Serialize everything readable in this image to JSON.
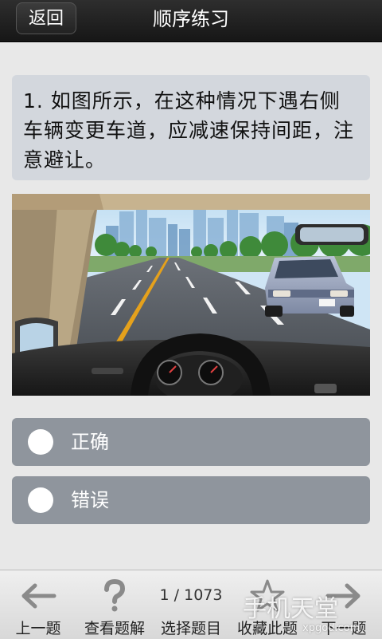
{
  "header": {
    "back_label": "返回",
    "title": "顺序练习"
  },
  "question": {
    "text": "1. 如图所示，在这种情况下遇右侧车辆变更车道，应减速保持间距，注意避让。"
  },
  "options": [
    {
      "label": "正确"
    },
    {
      "label": "错误"
    }
  ],
  "toolbar": {
    "prev_label": "上一题",
    "explain_label": "查看题解",
    "counter": "1 / 1073",
    "select_label": "选择题目",
    "favorite_label": "收藏此题",
    "next_label": "下一题"
  },
  "watermark": {
    "text": "手机天堂",
    "url": "xpgod.com"
  },
  "icons": {
    "back": "arrow-left-icon",
    "explain": "question-mark-icon",
    "favorite": "star-icon",
    "next": "arrow-right-icon"
  }
}
